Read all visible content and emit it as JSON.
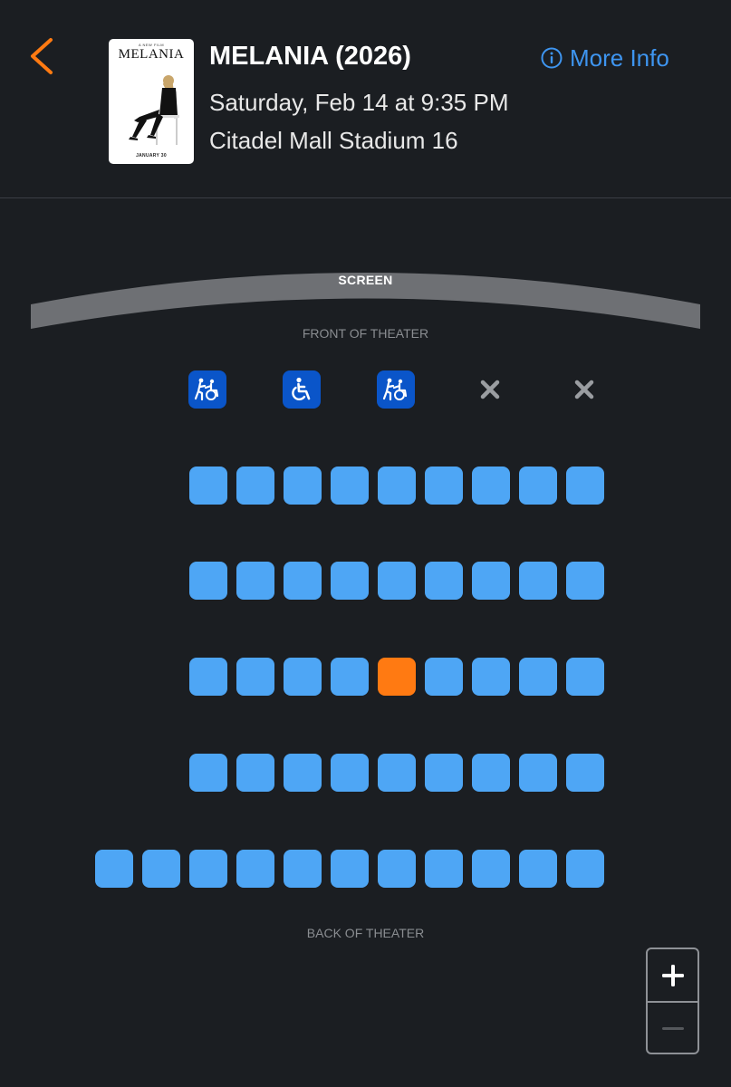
{
  "header": {
    "back_icon": "chevron-left-icon",
    "poster": {
      "tagline": "A NEW FILM",
      "title": "MELANIA",
      "release": "JANUARY 30"
    },
    "movie_title": "MELANIA (2026)",
    "showtime": "Saturday, Feb 14 at 9:35 PM",
    "venue": "Citadel Mall Stadium 16",
    "more_info_label": "More Info",
    "more_info_icon": "info-circle-icon"
  },
  "seatmap": {
    "screen_label": "SCREEN",
    "front_label": "FRONT OF THEATER",
    "back_label": "BACK OF THEATER",
    "rows": [
      {
        "seats": [
          {
            "status": "accessible-companion"
          },
          {
            "status": "wheelchair"
          },
          {
            "status": "accessible-companion"
          },
          {
            "status": "unavailable"
          },
          {
            "status": "unavailable"
          }
        ]
      },
      {
        "seats": [
          "available",
          "available",
          "available",
          "available",
          "available",
          "available",
          "available",
          "available",
          "available"
        ]
      },
      {
        "seats": [
          "available",
          "available",
          "available",
          "available",
          "available",
          "available",
          "available",
          "available",
          "available"
        ]
      },
      {
        "seats": [
          "available",
          "available",
          "available",
          "available",
          "selected",
          "available",
          "available",
          "available",
          "available"
        ]
      },
      {
        "seats": [
          "available",
          "available",
          "available",
          "available",
          "available",
          "available",
          "available",
          "available",
          "available"
        ]
      },
      {
        "seats": [
          "available",
          "available",
          "available",
          "available",
          "available",
          "available",
          "available",
          "available",
          "available",
          "available",
          "available"
        ]
      }
    ]
  },
  "zoom": {
    "in_icon": "plus-icon",
    "out_icon": "minus-icon"
  },
  "colors": {
    "background": "#1b1e22",
    "seat_available": "#4ea6f5",
    "seat_selected": "#ff7a12",
    "seat_accessible": "#0a55c9",
    "accent_orange": "#ff7a12",
    "link_blue": "#3e95f0"
  }
}
